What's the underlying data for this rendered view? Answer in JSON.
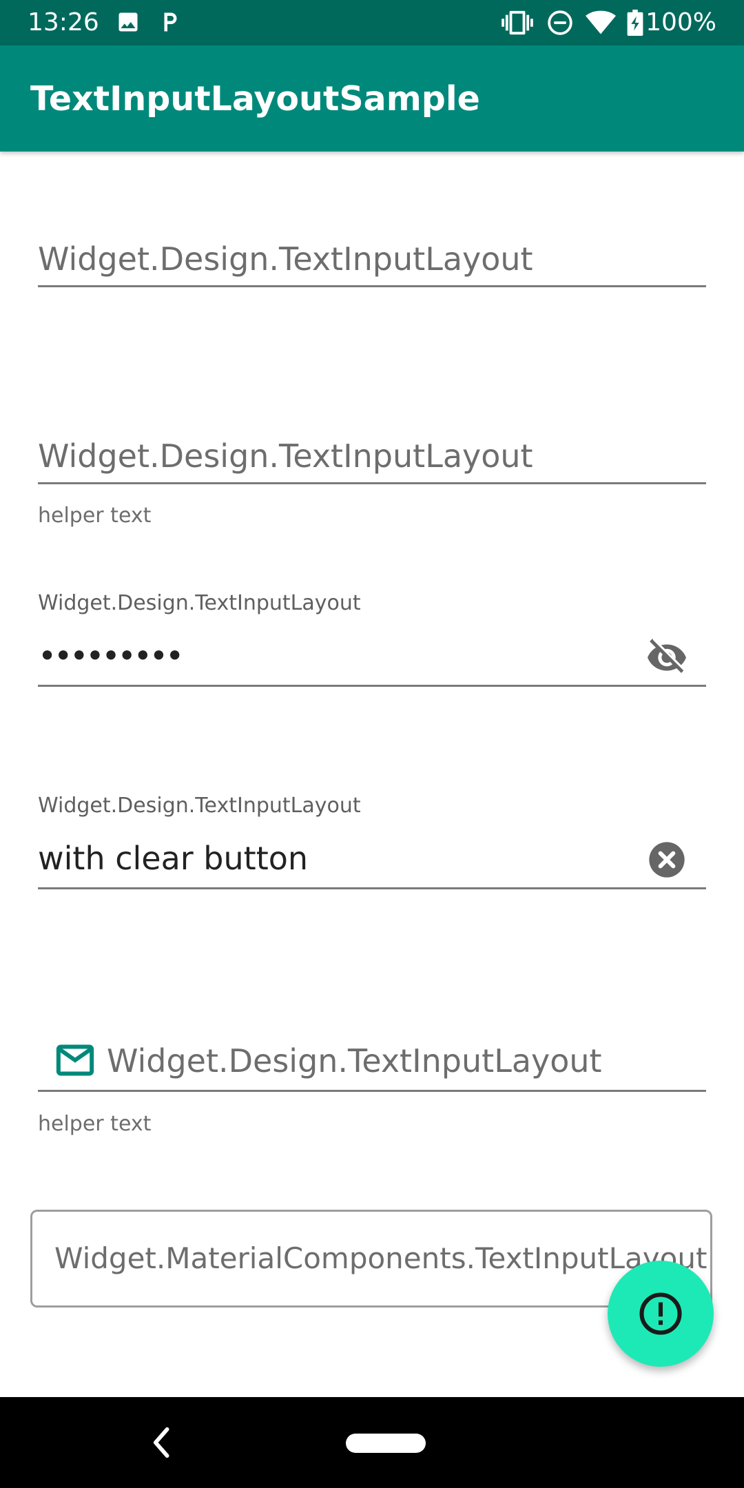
{
  "status_bar": {
    "time": "13:26",
    "battery": "100%",
    "icons": [
      "image-icon",
      "parking-icon",
      "vibrate-icon",
      "do-not-disturb-icon",
      "wifi-icon",
      "battery-charging-icon"
    ]
  },
  "app_bar": {
    "title": "TextInputLayoutSample",
    "color": "#00897b"
  },
  "fields": {
    "f1": {
      "hint": "Widget.Design.TextInputLayout"
    },
    "f2": {
      "hint": "Widget.Design.TextInputLayout",
      "helper": "helper text"
    },
    "f3": {
      "label": "Widget.Design.TextInputLayout",
      "value": "•••••••••",
      "end_icon": "visibility-off-icon"
    },
    "f4": {
      "label": "Widget.Design.TextInputLayout",
      "value": "with clear button",
      "end_icon": "clear-icon"
    },
    "f5": {
      "hint": "Widget.Design.TextInputLayout",
      "helper": "helper text",
      "start_icon": "mail-icon"
    },
    "f6": {
      "hint": "Widget.MaterialComponents.TextInputLayout..."
    }
  },
  "fab": {
    "icon": "error-icon",
    "color": "#1de9b6"
  },
  "nav": {
    "back_icon": "back-icon",
    "home": "home-pill"
  }
}
